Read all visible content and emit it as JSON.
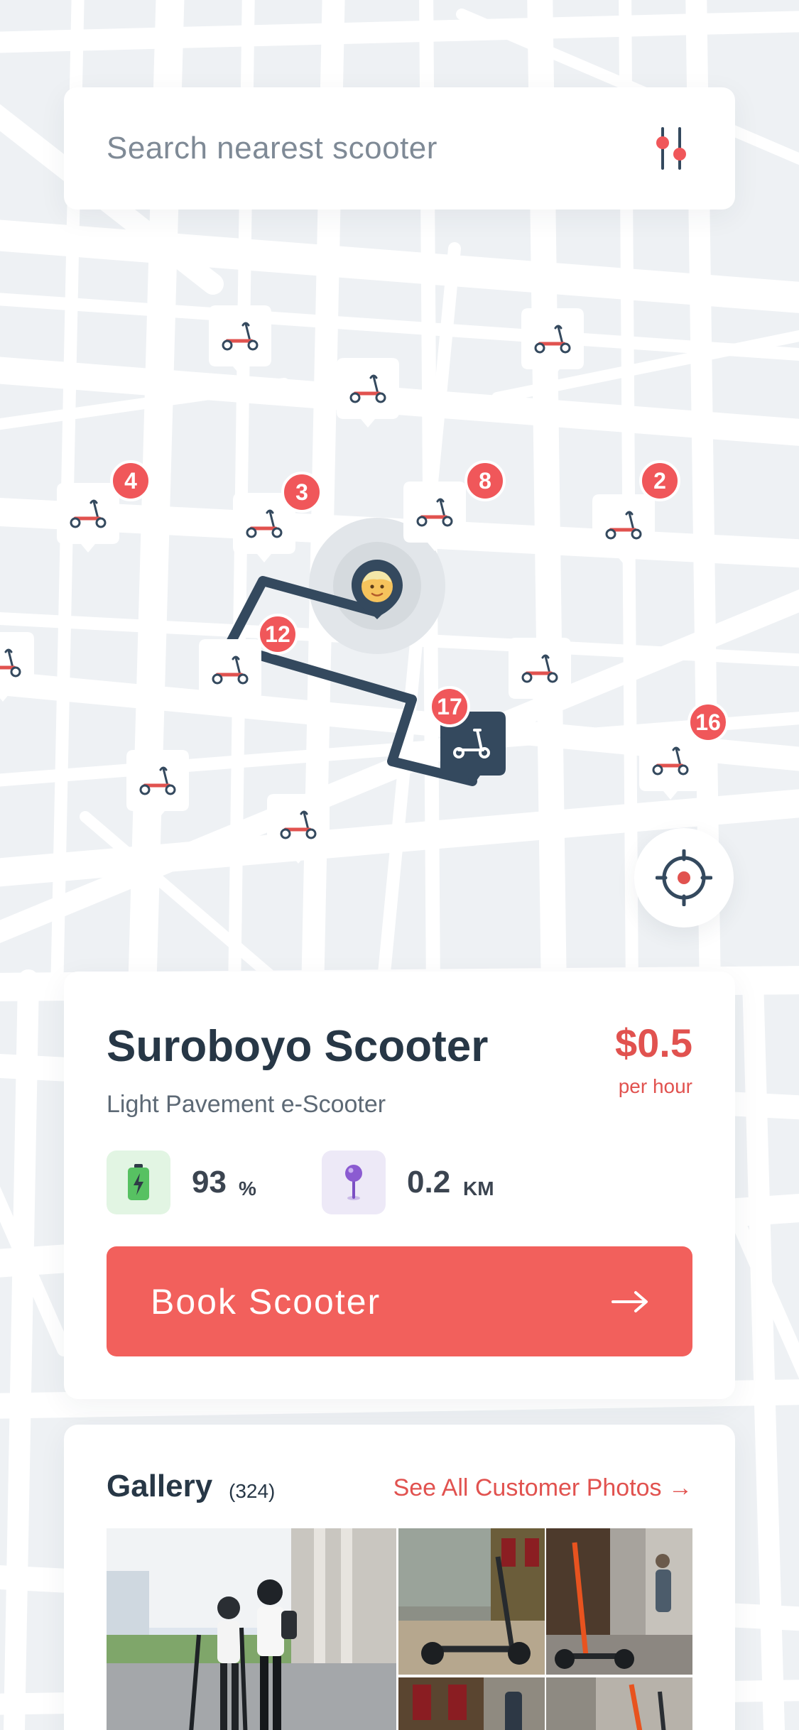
{
  "search": {
    "placeholder": "Search nearest scooter"
  },
  "map": {
    "badges": [
      "4",
      "3",
      "8",
      "2",
      "12",
      "17",
      "16"
    ]
  },
  "scooter": {
    "name": "Suroboyo Scooter",
    "type": "Light Pavement e-Scooter",
    "price": "$0.5",
    "price_unit": "per hour",
    "battery_value": "93",
    "battery_unit": "%",
    "distance_value": "0.2",
    "distance_unit": "KM",
    "book_label": "Book Scooter"
  },
  "gallery": {
    "title": "Gallery",
    "count": "(324)",
    "link_label": "See All Customer Photos →"
  },
  "colors": {
    "accent": "#f2605c",
    "dark": "#273746",
    "map_background": "#eef1f4",
    "road": "#ffffff"
  },
  "icons": [
    "filter-icon",
    "scooter-icon",
    "user-avatar-icon",
    "crosshair-icon",
    "battery-icon",
    "location-pin-icon",
    "arrow-right-icon"
  ]
}
